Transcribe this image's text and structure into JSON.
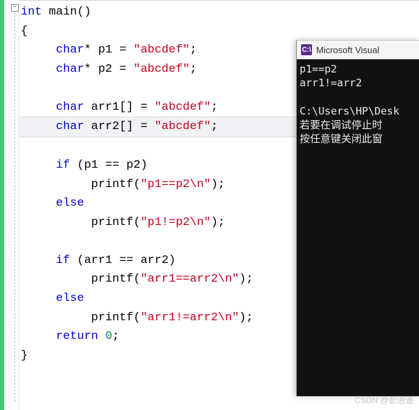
{
  "editor": {
    "fold_icon": "−",
    "sig_kw": "int",
    "sig_name": " main()",
    "brace_open": "{",
    "brace_close": "}",
    "indent1": "     ",
    "indent2": "          ",
    "l_char": "char",
    "l_star_p1": "* p1 = ",
    "l_star_p2": "* p2 = ",
    "l_arr1": " arr1[] = ",
    "l_arr2": " arr2[] = ",
    "str_abcdef": "\"abcdef\"",
    "semi": ";",
    "kw_if": "if",
    "kw_else": "else",
    "kw_return": "return",
    "num_zero": "0",
    "if_p": " (p1 == p2)",
    "if_arr": " (arr1 == arr2)",
    "printf": "printf(",
    "rparen_semi": ");",
    "str_p1eq": "\"p1==p2\\n\"",
    "str_p1ne": "\"p1!=p2\\n\"",
    "str_arreq": "\"arr1==arr2\\n\"",
    "str_arrne": "\"arr1!=arr2\\n\""
  },
  "console": {
    "title": "Microsoft Visual",
    "logo_text": "C:\\",
    "out1": "p1==p2",
    "out2": "arr1!=arr2",
    "path": "C:\\Users\\HP\\Desk",
    "msg1": "若要在调试停止时",
    "msg2": "按任意键关闭此窗"
  },
  "watermark": "CSDN @彭逍遥"
}
